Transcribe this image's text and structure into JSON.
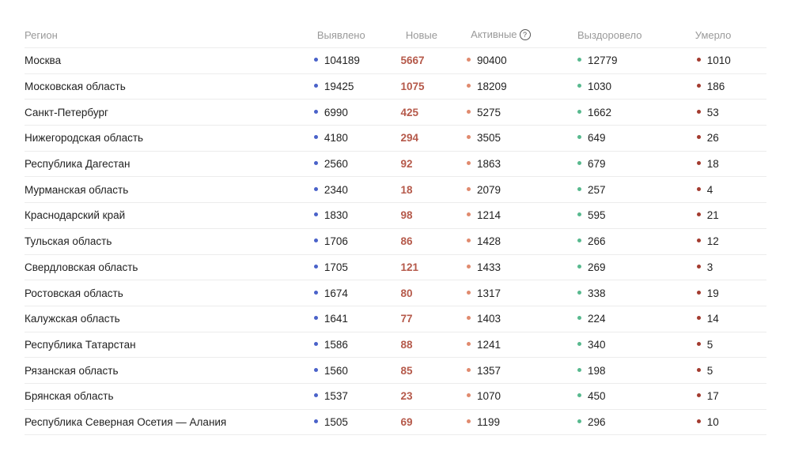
{
  "colors": {
    "detected": "#4a62c9",
    "new": "#b5594a",
    "active": "#e08a6e",
    "recovered": "#58b98e",
    "died": "#a33b2f"
  },
  "header": {
    "region": "Регион",
    "detected": "Выявлено",
    "new": "Новые",
    "active": "Активные",
    "active_info_icon": "?",
    "recovered": "Выздоровело",
    "died": "Умерло"
  },
  "rows": [
    {
      "region": "Москва",
      "detected": "104189",
      "new": "5667",
      "active": "90400",
      "recovered": "12779",
      "died": "1010"
    },
    {
      "region": "Московская область",
      "detected": "19425",
      "new": "1075",
      "active": "18209",
      "recovered": "1030",
      "died": "186"
    },
    {
      "region": "Санкт-Петербург",
      "detected": "6990",
      "new": "425",
      "active": "5275",
      "recovered": "1662",
      "died": "53"
    },
    {
      "region": "Нижегородская область",
      "detected": "4180",
      "new": "294",
      "active": "3505",
      "recovered": "649",
      "died": "26"
    },
    {
      "region": "Республика Дагестан",
      "detected": "2560",
      "new": "92",
      "active": "1863",
      "recovered": "679",
      "died": "18"
    },
    {
      "region": "Мурманская область",
      "detected": "2340",
      "new": "18",
      "active": "2079",
      "recovered": "257",
      "died": "4"
    },
    {
      "region": "Краснодарский край",
      "detected": "1830",
      "new": "98",
      "active": "1214",
      "recovered": "595",
      "died": "21"
    },
    {
      "region": "Тульская область",
      "detected": "1706",
      "new": "86",
      "active": "1428",
      "recovered": "266",
      "died": "12"
    },
    {
      "region": "Свердловская область",
      "detected": "1705",
      "new": "121",
      "active": "1433",
      "recovered": "269",
      "died": "3"
    },
    {
      "region": "Ростовская область",
      "detected": "1674",
      "new": "80",
      "active": "1317",
      "recovered": "338",
      "died": "19"
    },
    {
      "region": "Калужская область",
      "detected": "1641",
      "new": "77",
      "active": "1403",
      "recovered": "224",
      "died": "14"
    },
    {
      "region": "Республика Татарстан",
      "detected": "1586",
      "new": "88",
      "active": "1241",
      "recovered": "340",
      "died": "5"
    },
    {
      "region": "Рязанская область",
      "detected": "1560",
      "new": "85",
      "active": "1357",
      "recovered": "198",
      "died": "5"
    },
    {
      "region": "Брянская область",
      "detected": "1537",
      "new": "23",
      "active": "1070",
      "recovered": "450",
      "died": "17"
    },
    {
      "region": "Республика Северная Осетия — Алания",
      "detected": "1505",
      "new": "69",
      "active": "1199",
      "recovered": "296",
      "died": "10"
    }
  ]
}
